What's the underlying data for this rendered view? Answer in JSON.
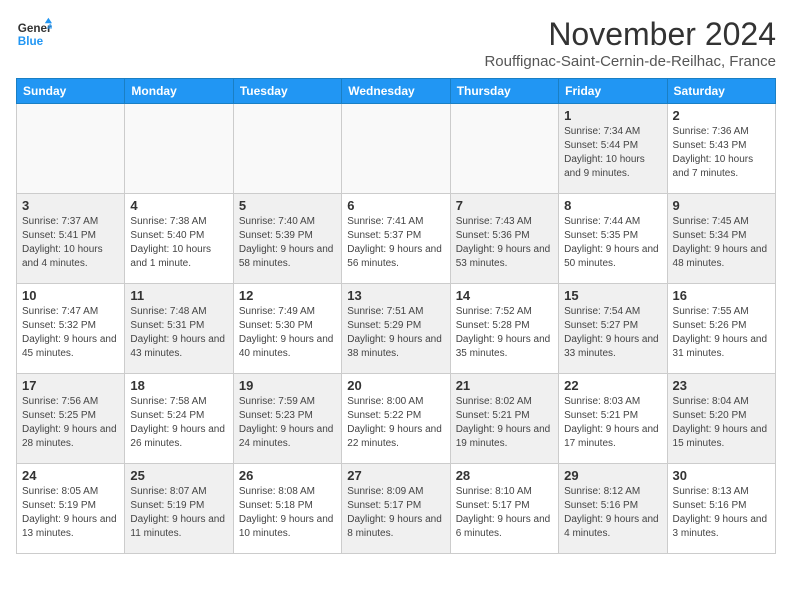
{
  "header": {
    "logo_general": "General",
    "logo_blue": "Blue",
    "month": "November 2024",
    "location": "Rouffignac-Saint-Cernin-de-Reilhac, France"
  },
  "days_of_week": [
    "Sunday",
    "Monday",
    "Tuesday",
    "Wednesday",
    "Thursday",
    "Friday",
    "Saturday"
  ],
  "weeks": [
    [
      {
        "day": "",
        "info": "",
        "empty": true
      },
      {
        "day": "",
        "info": "",
        "empty": true
      },
      {
        "day": "",
        "info": "",
        "empty": true
      },
      {
        "day": "",
        "info": "",
        "empty": true
      },
      {
        "day": "",
        "info": "",
        "empty": true
      },
      {
        "day": "1",
        "info": "Sunrise: 7:34 AM\nSunset: 5:44 PM\nDaylight: 10 hours and 9 minutes.",
        "shaded": true
      },
      {
        "day": "2",
        "info": "Sunrise: 7:36 AM\nSunset: 5:43 PM\nDaylight: 10 hours and 7 minutes.",
        "shaded": false
      }
    ],
    [
      {
        "day": "3",
        "info": "Sunrise: 7:37 AM\nSunset: 5:41 PM\nDaylight: 10 hours and 4 minutes.",
        "shaded": true
      },
      {
        "day": "4",
        "info": "Sunrise: 7:38 AM\nSunset: 5:40 PM\nDaylight: 10 hours and 1 minute.",
        "shaded": false
      },
      {
        "day": "5",
        "info": "Sunrise: 7:40 AM\nSunset: 5:39 PM\nDaylight: 9 hours and 58 minutes.",
        "shaded": true
      },
      {
        "day": "6",
        "info": "Sunrise: 7:41 AM\nSunset: 5:37 PM\nDaylight: 9 hours and 56 minutes.",
        "shaded": false
      },
      {
        "day": "7",
        "info": "Sunrise: 7:43 AM\nSunset: 5:36 PM\nDaylight: 9 hours and 53 minutes.",
        "shaded": true
      },
      {
        "day": "8",
        "info": "Sunrise: 7:44 AM\nSunset: 5:35 PM\nDaylight: 9 hours and 50 minutes.",
        "shaded": false
      },
      {
        "day": "9",
        "info": "Sunrise: 7:45 AM\nSunset: 5:34 PM\nDaylight: 9 hours and 48 minutes.",
        "shaded": true
      }
    ],
    [
      {
        "day": "10",
        "info": "Sunrise: 7:47 AM\nSunset: 5:32 PM\nDaylight: 9 hours and 45 minutes.",
        "shaded": false
      },
      {
        "day": "11",
        "info": "Sunrise: 7:48 AM\nSunset: 5:31 PM\nDaylight: 9 hours and 43 minutes.",
        "shaded": true
      },
      {
        "day": "12",
        "info": "Sunrise: 7:49 AM\nSunset: 5:30 PM\nDaylight: 9 hours and 40 minutes.",
        "shaded": false
      },
      {
        "day": "13",
        "info": "Sunrise: 7:51 AM\nSunset: 5:29 PM\nDaylight: 9 hours and 38 minutes.",
        "shaded": true
      },
      {
        "day": "14",
        "info": "Sunrise: 7:52 AM\nSunset: 5:28 PM\nDaylight: 9 hours and 35 minutes.",
        "shaded": false
      },
      {
        "day": "15",
        "info": "Sunrise: 7:54 AM\nSunset: 5:27 PM\nDaylight: 9 hours and 33 minutes.",
        "shaded": true
      },
      {
        "day": "16",
        "info": "Sunrise: 7:55 AM\nSunset: 5:26 PM\nDaylight: 9 hours and 31 minutes.",
        "shaded": false
      }
    ],
    [
      {
        "day": "17",
        "info": "Sunrise: 7:56 AM\nSunset: 5:25 PM\nDaylight: 9 hours and 28 minutes.",
        "shaded": true
      },
      {
        "day": "18",
        "info": "Sunrise: 7:58 AM\nSunset: 5:24 PM\nDaylight: 9 hours and 26 minutes.",
        "shaded": false
      },
      {
        "day": "19",
        "info": "Sunrise: 7:59 AM\nSunset: 5:23 PM\nDaylight: 9 hours and 24 minutes.",
        "shaded": true
      },
      {
        "day": "20",
        "info": "Sunrise: 8:00 AM\nSunset: 5:22 PM\nDaylight: 9 hours and 22 minutes.",
        "shaded": false
      },
      {
        "day": "21",
        "info": "Sunrise: 8:02 AM\nSunset: 5:21 PM\nDaylight: 9 hours and 19 minutes.",
        "shaded": true
      },
      {
        "day": "22",
        "info": "Sunrise: 8:03 AM\nSunset: 5:21 PM\nDaylight: 9 hours and 17 minutes.",
        "shaded": false
      },
      {
        "day": "23",
        "info": "Sunrise: 8:04 AM\nSunset: 5:20 PM\nDaylight: 9 hours and 15 minutes.",
        "shaded": true
      }
    ],
    [
      {
        "day": "24",
        "info": "Sunrise: 8:05 AM\nSunset: 5:19 PM\nDaylight: 9 hours and 13 minutes.",
        "shaded": false
      },
      {
        "day": "25",
        "info": "Sunrise: 8:07 AM\nSunset: 5:19 PM\nDaylight: 9 hours and 11 minutes.",
        "shaded": true
      },
      {
        "day": "26",
        "info": "Sunrise: 8:08 AM\nSunset: 5:18 PM\nDaylight: 9 hours and 10 minutes.",
        "shaded": false
      },
      {
        "day": "27",
        "info": "Sunrise: 8:09 AM\nSunset: 5:17 PM\nDaylight: 9 hours and 8 minutes.",
        "shaded": true
      },
      {
        "day": "28",
        "info": "Sunrise: 8:10 AM\nSunset: 5:17 PM\nDaylight: 9 hours and 6 minutes.",
        "shaded": false
      },
      {
        "day": "29",
        "info": "Sunrise: 8:12 AM\nSunset: 5:16 PM\nDaylight: 9 hours and 4 minutes.",
        "shaded": true
      },
      {
        "day": "30",
        "info": "Sunrise: 8:13 AM\nSunset: 5:16 PM\nDaylight: 9 hours and 3 minutes.",
        "shaded": false
      }
    ]
  ]
}
